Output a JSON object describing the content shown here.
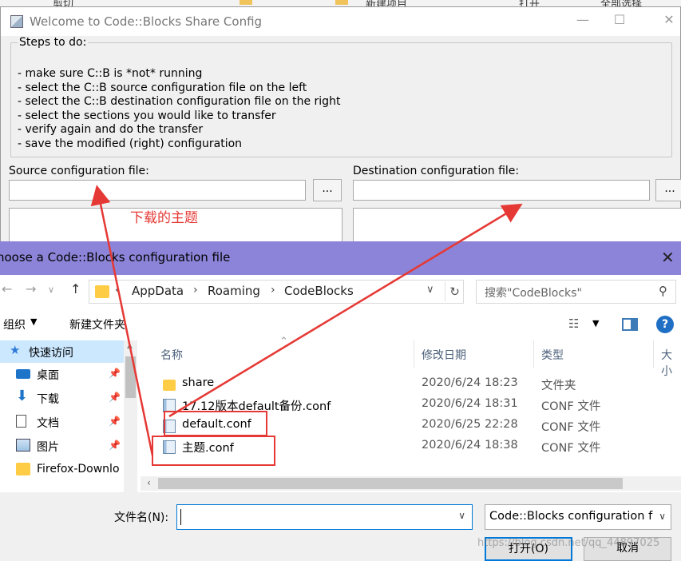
{
  "bg_toolbar": {
    "cut": "剪切",
    "new_item": "新建项目",
    "open": "打开",
    "select_all": "全部选择"
  },
  "share_window": {
    "title": "Welcome to Code::Blocks Share Config",
    "steps_title": "Steps to do:",
    "steps": [
      "- make sure C::B is *not* running",
      "- select the C::B source configuration file on the left",
      "- select the C::B destination configuration file on the right",
      "- select the sections you would like to transfer",
      "- verify again and do the transfer",
      "- save the modified (right) configuration"
    ],
    "source_label": "Source configuration file:",
    "dest_label": "Destination configuration file:",
    "browse_label": "...",
    "source_value": "",
    "dest_value": ""
  },
  "annotation": {
    "text": "下载的主题",
    "color": "#e53935"
  },
  "dialog": {
    "title": "hoose a Code::Blocks configuration file",
    "title_bar_color": "#8c84d8",
    "breadcrumb": [
      "AppData",
      "Roaming",
      "CodeBlocks"
    ],
    "search_placeholder": "搜索\"CodeBlocks\"",
    "organize_label": "组织",
    "new_folder_label": "新建文件夹",
    "sidebar": [
      {
        "label": "快速访问",
        "icon": "star-icon",
        "selected": true
      },
      {
        "label": "桌面",
        "icon": "desktop-icon",
        "pinned": true
      },
      {
        "label": "下载",
        "icon": "download-icon",
        "pinned": true
      },
      {
        "label": "文档",
        "icon": "document-icon",
        "pinned": true
      },
      {
        "label": "图片",
        "icon": "picture-icon",
        "pinned": true
      },
      {
        "label": "Firefox-Downlo",
        "icon": "folder-icon"
      }
    ],
    "columns": {
      "name": "名称",
      "modified": "修改日期",
      "type": "类型",
      "size": "大小"
    },
    "files": [
      {
        "name": "share",
        "modified": "2020/6/24 18:23",
        "type": "文件夹",
        "kind": "folder"
      },
      {
        "name": "17.12版本default备份.conf",
        "modified": "2020/6/24 18:31",
        "type": "CONF 文件",
        "kind": "file"
      },
      {
        "name": "default.conf",
        "modified": "2020/6/25 22:28",
        "type": "CONF 文件",
        "kind": "file"
      },
      {
        "name": "主题.conf",
        "modified": "2020/6/24 18:38",
        "type": "CONF 文件",
        "kind": "file"
      }
    ],
    "filename_label": "文件名(N):",
    "filename_value": "",
    "filetype_value": "Code::Blocks configuration f",
    "open_button": "打开(O)",
    "cancel_button": "取消"
  },
  "watermark": "https://blog.csdn.net/qq_44897025"
}
